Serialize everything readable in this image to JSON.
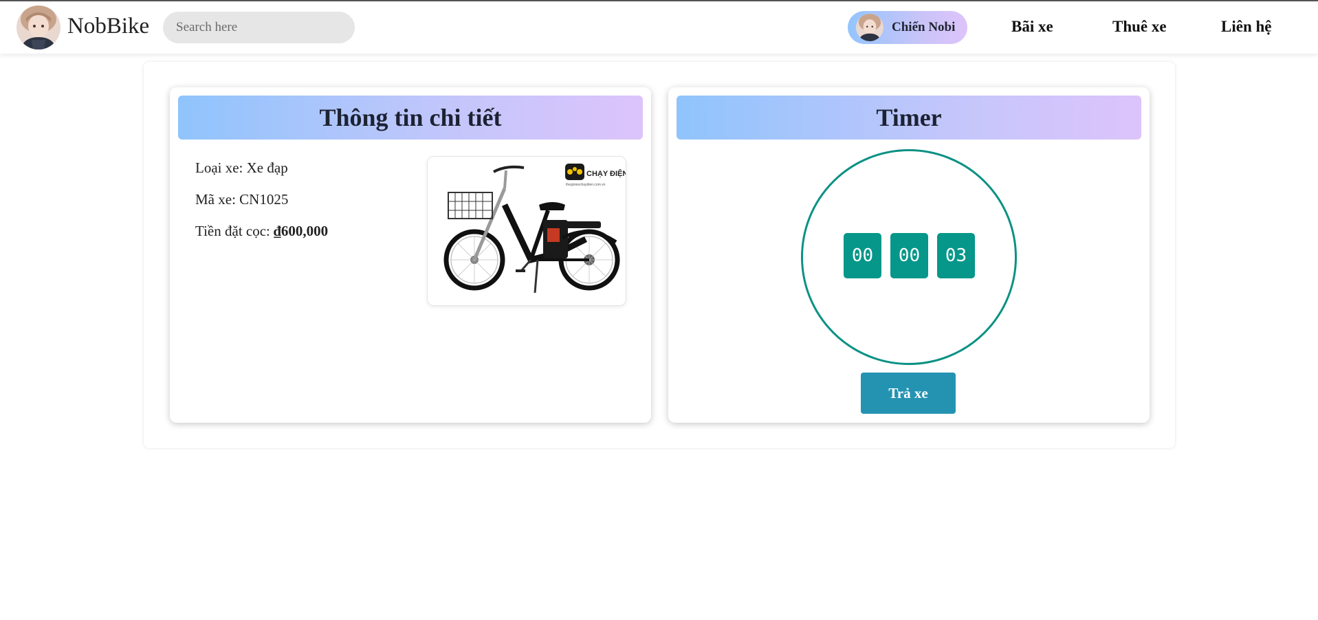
{
  "header": {
    "brand": "NobBike",
    "search_placeholder": "Search here",
    "user_name": "Chiến Nobi",
    "nav": [
      "Bãi xe",
      "Thuê xe",
      "Liên hệ"
    ]
  },
  "details": {
    "title": "Thông tin chi tiết",
    "type_label": "Loại xe:",
    "type_value": "Xe đạp",
    "code_label": "Mã xe:",
    "code_value": "CN1025",
    "deposit_label": "Tiền đặt cọc:",
    "deposit_value": "₫600,000",
    "image_logo_text": "CHẠY ĐIỆN",
    "image_logo_url": "thegioixechaydien.com.vn"
  },
  "timer": {
    "title": "Timer",
    "hours": "00",
    "minutes": "00",
    "seconds": "03",
    "return_label": "Trả xe"
  },
  "colors": {
    "accent_teal": "#06978a",
    "button_blue": "#2493b2",
    "gradient_start": "#90c4fc",
    "gradient_end": "#dcc4fb"
  }
}
